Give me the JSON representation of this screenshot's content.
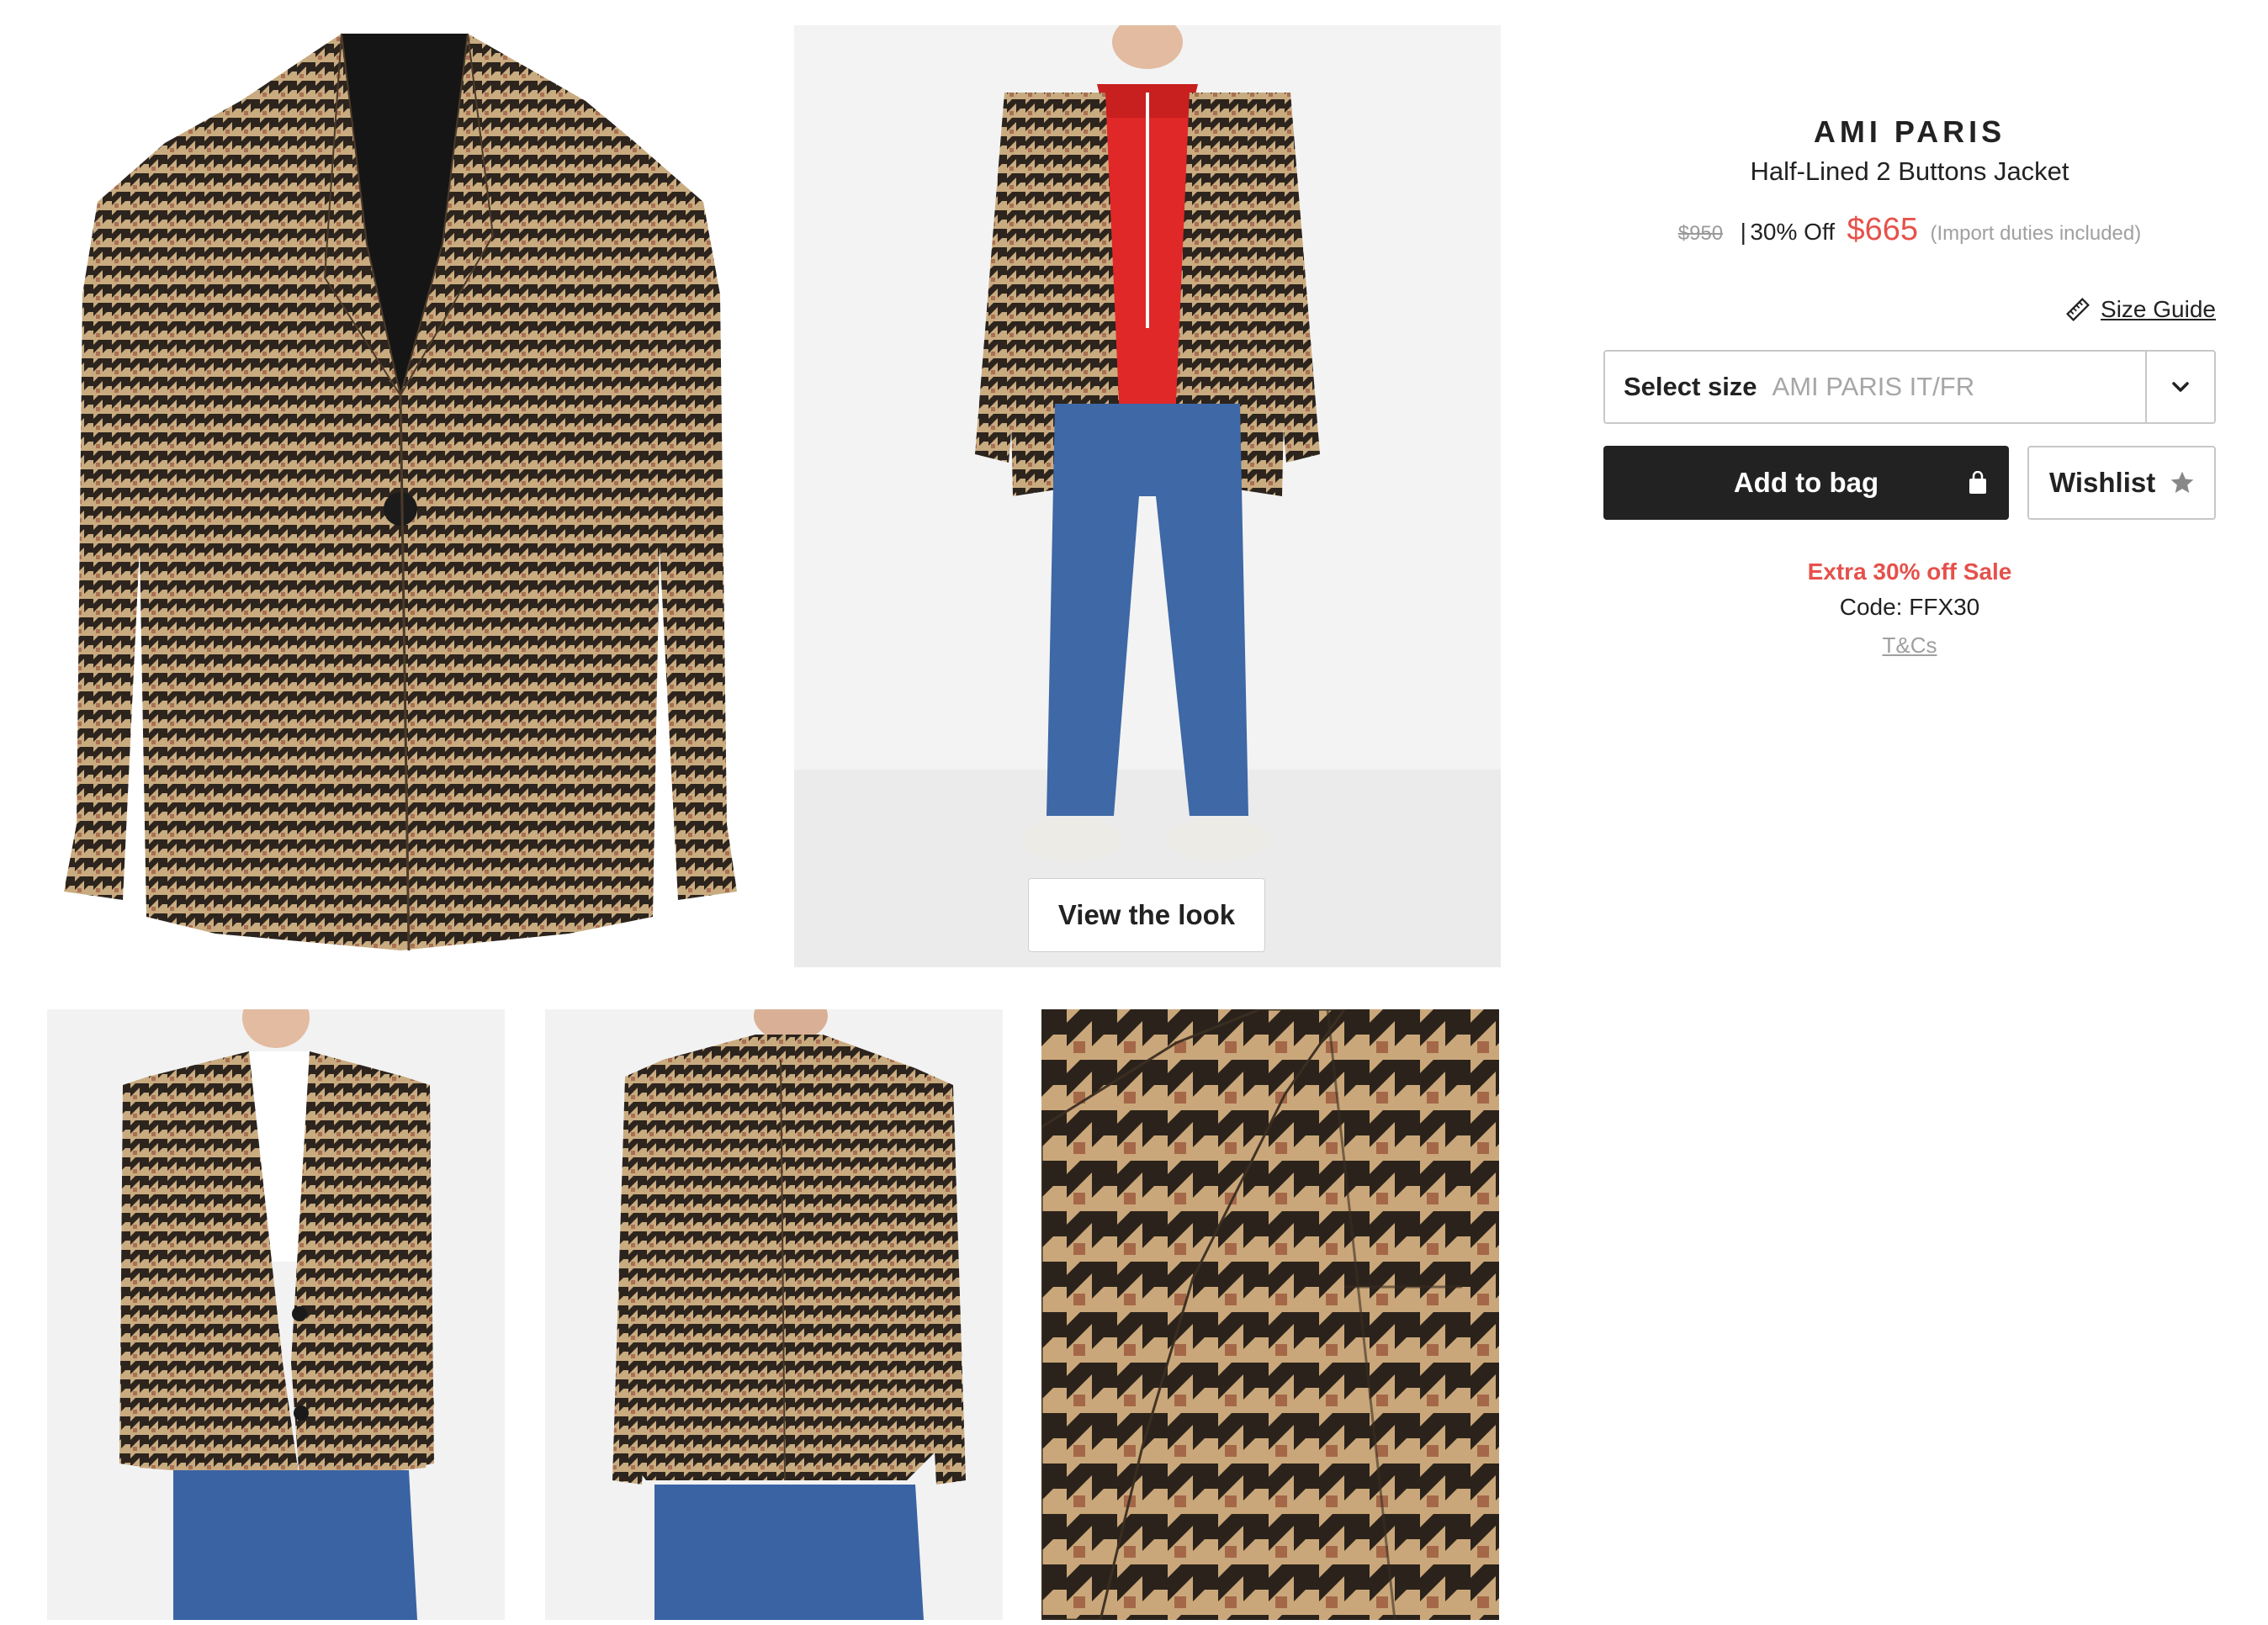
{
  "product": {
    "brand": "AMI PARIS",
    "name": "Half-Lined 2 Buttons Jacket",
    "price_original": "$950",
    "price_separator": "|",
    "discount": "30% Off",
    "price_sale": "$665",
    "price_note": "(Import duties included)"
  },
  "size": {
    "guide_label": "Size Guide",
    "select_label": "Select size",
    "select_hint": "AMI PARIS IT/FR"
  },
  "actions": {
    "add_to_bag": "Add to bag",
    "wishlist": "Wishlist"
  },
  "promo": {
    "title": "Extra 30% off Sale",
    "code": "Code: FFX30",
    "terms": "T&Cs"
  },
  "gallery": {
    "view_look": "View the look"
  },
  "colors": {
    "accent_red": "#e6514b",
    "button_dark": "#222222",
    "muted_text": "#a0a0a0"
  },
  "icons": {
    "size_guide": "ruler-icon",
    "size_select": "chevron-down-icon",
    "add_to_bag": "shopping-bag-icon",
    "wishlist": "star-icon"
  }
}
